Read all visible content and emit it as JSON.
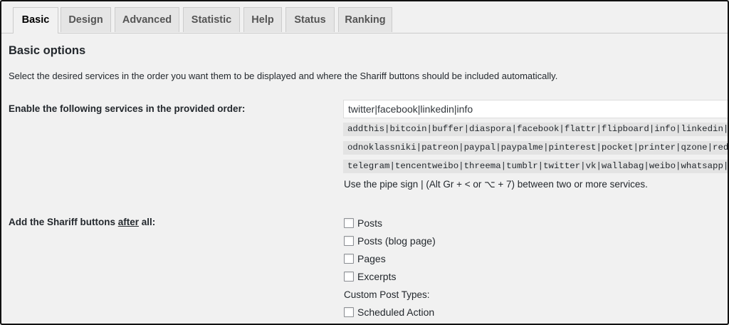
{
  "tabs": [
    {
      "label": "Basic",
      "active": true
    },
    {
      "label": "Design"
    },
    {
      "label": "Advanced"
    },
    {
      "label": "Statistic"
    },
    {
      "label": "Help"
    },
    {
      "label": "Status"
    },
    {
      "label": "Ranking"
    }
  ],
  "section": {
    "heading": "Basic options",
    "description": "Select the desired services in the order you want them to be displayed and where the Shariff buttons should be included automatically."
  },
  "services": {
    "label": "Enable the following services in the provided order:",
    "value": "twitter|facebook|linkedin|info",
    "available": [
      "addthis|bitcoin|buffer|diaspora|facebook|flattr|flipboard|info|linkedin|mailto|",
      "odnoklassniki|patreon|paypal|paypalme|pinterest|pocket|printer|qzone|reddit|",
      "telegram|tencentweibo|threema|tumblr|twitter|vk|wallabag|weibo|whatsapp|xing"
    ],
    "hint": "Use the pipe sign | (Alt Gr + < or ⌥ + 7) between two or more services."
  },
  "placement": {
    "label_prefix": "Add the Shariff buttons ",
    "label_emphasis": "after",
    "label_suffix": " all:",
    "options": [
      "Posts",
      "Posts (blog page)",
      "Pages",
      "Excerpts"
    ],
    "custom_post_types_label": "Custom Post Types:",
    "custom_options": [
      "Scheduled Action"
    ]
  },
  "colors": {
    "background": "#f1f1f1",
    "tab_inactive": "#e5e5e5",
    "code_background": "#e3e3e3"
  }
}
